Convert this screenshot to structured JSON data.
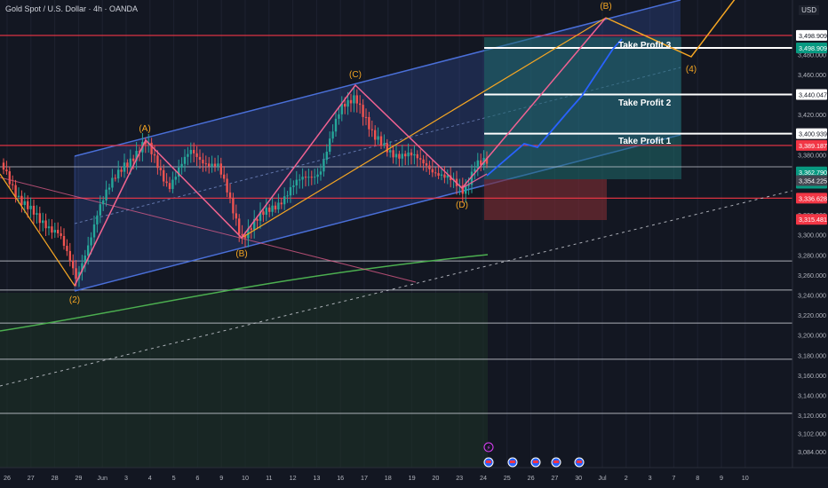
{
  "header": {
    "symbol_title": "Gold Spot / U.S. Dollar · 4h · OANDA",
    "currency": "USD"
  },
  "colors": {
    "background": "#131722",
    "channel": "#4a6fd8",
    "red_line": "#f23645",
    "orange": "#f5a623",
    "pink": "#f06292",
    "green_ma": "#4caf50",
    "blue_path": "#2962ff",
    "bull": "#26a69a",
    "bear": "#ef5350"
  },
  "chart_data": {
    "type": "candlestick",
    "timeframe": "4h",
    "y_axis": {
      "min": 3075,
      "max": 3513,
      "ticks": [
        3084,
        3102,
        3120,
        3140,
        3160,
        3180,
        3200,
        3220,
        3240,
        3260,
        3280,
        3300,
        3320,
        3340,
        3360,
        3380,
        3400,
        3420,
        3440,
        3460,
        3480
      ],
      "tick_labels": [
        "3,084.000",
        "3,102.000",
        "3,120.000",
        "3,140.000",
        "3,160.000",
        "3,180.000",
        "3,200.000",
        "3,220.000",
        "3,240.000",
        "3,260.000",
        "3,280.000",
        "3,300.000",
        "3,320.000",
        "3,340.000",
        "3,360.000",
        "3,380.000",
        "3,400.000",
        "3,420.000",
        "3,440.000",
        "3,460.000",
        "3,480.000"
      ]
    },
    "x_axis": {
      "labels": [
        "26",
        "27",
        "28",
        "29",
        "Jun",
        "3",
        "4",
        "5",
        "6",
        "9",
        "10",
        "11",
        "12",
        "13",
        "16",
        "17",
        "18",
        "19",
        "20",
        "23",
        "24",
        "25",
        "26",
        "27",
        "30",
        "Jul",
        "2",
        "3",
        "7",
        "8",
        "9",
        "10"
      ]
    },
    "price_labels": [
      {
        "value": 3498.909,
        "text": "3,498.909",
        "style": "white"
      },
      {
        "value": 3486.5,
        "text": "3,498.909",
        "style": "green"
      },
      {
        "value": 3440.047,
        "text": "3,440.047",
        "style": "white"
      },
      {
        "value": 3400.939,
        "text": "3,400.939",
        "style": "white"
      },
      {
        "value": 3389.187,
        "text": "3,389.187",
        "style": "red"
      },
      {
        "value": 3362.79,
        "text": "3,362.790",
        "style": "teal"
      },
      {
        "value": 3351.5,
        "text": "03:58:08",
        "style": "teal"
      },
      {
        "value": 3354.225,
        "text": "3,354.225",
        "style": "gray"
      },
      {
        "value": 3336.628,
        "text": "3,336.628",
        "style": "red"
      },
      {
        "value": 3315.481,
        "text": "3,315.481",
        "style": "red"
      }
    ],
    "take_profits": [
      {
        "label": "Take Profit 3",
        "value": 3486.5
      },
      {
        "label": "Take Profit 2",
        "value": 3440.047
      },
      {
        "label": "Take Profit 1",
        "value": 3400.939
      }
    ],
    "wave_labels": [
      "(A)",
      "(B)",
      "(C)",
      "(D)",
      "(B)",
      "(2)",
      "(4)"
    ],
    "horizontal_levels": [
      3274,
      3245,
      3212,
      3176,
      3122
    ],
    "red_levels": [
      3389.187,
      3336.628,
      3498.909
    ]
  }
}
